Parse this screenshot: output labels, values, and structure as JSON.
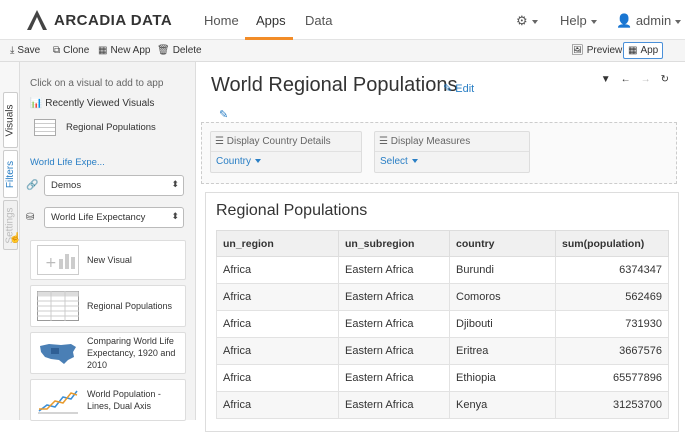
{
  "brand": {
    "name": "ARCADIA DATA"
  },
  "nav": {
    "links": [
      {
        "label": "Home"
      },
      {
        "label": "Apps"
      },
      {
        "label": "Data"
      }
    ],
    "active": "Apps",
    "help": "Help",
    "user": "admin"
  },
  "toolbar": {
    "save": "Save",
    "clone": "Clone",
    "new_app": "New App",
    "delete": "Delete",
    "preview": "Preview",
    "app": "App"
  },
  "vtabs": {
    "visuals": "Visuals",
    "filters": "Filters",
    "settings": "Settings"
  },
  "panel": {
    "hint": "Click on a visual to add to app",
    "recent_title": "Recently Viewed Visuals",
    "recent_item": "Regional Populations",
    "dataset_link": "World Life Expe...",
    "connection": "Demos",
    "dataset": "World Life Expectancy",
    "cards": [
      {
        "label": "New Visual"
      },
      {
        "label": "Regional Populations"
      },
      {
        "label": "Comparing World Life Expectancy, 1920 and 2010"
      },
      {
        "label": "World Population - Lines, Dual Axis"
      }
    ]
  },
  "main": {
    "title": "World Regional Populations",
    "edit": "Edit",
    "filters": [
      {
        "header": "Display Country Details",
        "value": "Country"
      },
      {
        "header": "Display Measures",
        "value": "Select"
      }
    ],
    "visual_title": "Regional Populations",
    "table": {
      "columns": [
        "un_region",
        "un_subregion",
        "country",
        "sum(population)"
      ],
      "rows": [
        [
          "Africa",
          "Eastern Africa",
          "Burundi",
          "6374347"
        ],
        [
          "Africa",
          "Eastern Africa",
          "Comoros",
          "562469"
        ],
        [
          "Africa",
          "Eastern Africa",
          "Djibouti",
          "731930"
        ],
        [
          "Africa",
          "Eastern Africa",
          "Eritrea",
          "3667576"
        ],
        [
          "Africa",
          "Eastern Africa",
          "Ethiopia",
          "65577896"
        ],
        [
          "Africa",
          "Eastern Africa",
          "Kenya",
          "31253700"
        ]
      ]
    }
  },
  "colors": {
    "accent": "#f28c28",
    "link": "#2a7fc5"
  }
}
